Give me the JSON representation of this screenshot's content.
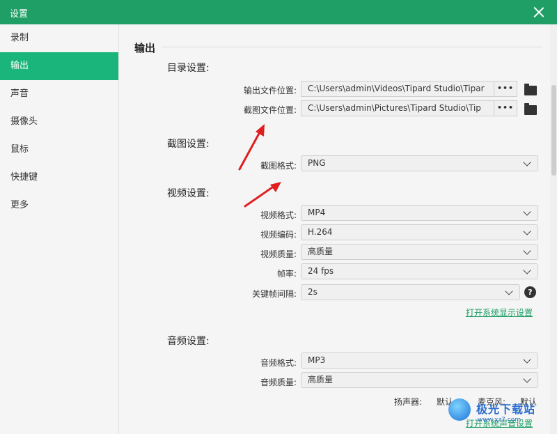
{
  "window": {
    "title": "设置"
  },
  "sidebar": {
    "items": [
      {
        "label": "录制",
        "active": false
      },
      {
        "label": "输出",
        "active": true
      },
      {
        "label": "声音",
        "active": false
      },
      {
        "label": "摄像头",
        "active": false
      },
      {
        "label": "鼠标",
        "active": false
      },
      {
        "label": "快捷键",
        "active": false
      },
      {
        "label": "更多",
        "active": false
      }
    ]
  },
  "main": {
    "section_title": "输出",
    "directory": {
      "title": "目录设置:",
      "output_label": "输出文件位置:",
      "output_path": "C:\\Users\\admin\\Videos\\Tipard Studio\\Tipar",
      "screenshot_label": "截图文件位置:",
      "screenshot_path": "C:\\Users\\admin\\Pictures\\Tipard Studio\\Tip",
      "browse_label": "•••"
    },
    "screenshot": {
      "title": "截图设置:",
      "format_label": "截图格式:",
      "format_value": "PNG"
    },
    "video": {
      "title": "视频设置:",
      "format_label": "视频格式:",
      "format_value": "MP4",
      "codec_label": "视频编码:",
      "codec_value": "H.264",
      "quality_label": "视频质量:",
      "quality_value": "高质量",
      "fps_label": "帧率:",
      "fps_value": "24 fps",
      "keyframe_label": "关键帧间隔:",
      "keyframe_value": "2s",
      "help_glyph": "?",
      "display_link": "打开系统显示设置"
    },
    "audio": {
      "title": "音频设置:",
      "format_label": "音频格式:",
      "format_value": "MP3",
      "quality_label": "音频质量:",
      "quality_value": "高质量",
      "speaker_label": "扬声器:",
      "speaker_value": "默认",
      "mic_label": "麦克风:",
      "mic_value": "默认",
      "sound_link": "打开系统声音设置"
    }
  },
  "watermark": {
    "text": "极光下载站",
    "url": "www.xz7.com"
  },
  "colors": {
    "accent": "#1ab57a",
    "titlebar": "#1f9f66",
    "link": "#1a9e63",
    "arrow": "#e02020"
  }
}
